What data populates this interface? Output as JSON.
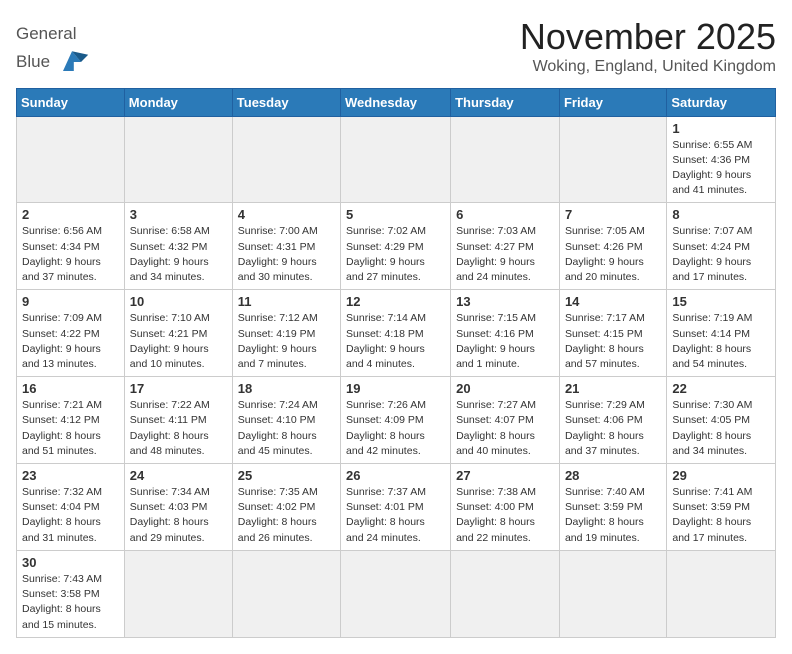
{
  "logo": {
    "line1": "General",
    "line2": "Blue"
  },
  "title": "November 2025",
  "subtitle": "Woking, England, United Kingdom",
  "headers": [
    "Sunday",
    "Monday",
    "Tuesday",
    "Wednesday",
    "Thursday",
    "Friday",
    "Saturday"
  ],
  "weeks": [
    [
      {
        "day": "",
        "info": ""
      },
      {
        "day": "",
        "info": ""
      },
      {
        "day": "",
        "info": ""
      },
      {
        "day": "",
        "info": ""
      },
      {
        "day": "",
        "info": ""
      },
      {
        "day": "",
        "info": ""
      },
      {
        "day": "1",
        "info": "Sunrise: 6:55 AM\nSunset: 4:36 PM\nDaylight: 9 hours and 41 minutes."
      }
    ],
    [
      {
        "day": "2",
        "info": "Sunrise: 6:56 AM\nSunset: 4:34 PM\nDaylight: 9 hours and 37 minutes."
      },
      {
        "day": "3",
        "info": "Sunrise: 6:58 AM\nSunset: 4:32 PM\nDaylight: 9 hours and 34 minutes."
      },
      {
        "day": "4",
        "info": "Sunrise: 7:00 AM\nSunset: 4:31 PM\nDaylight: 9 hours and 30 minutes."
      },
      {
        "day": "5",
        "info": "Sunrise: 7:02 AM\nSunset: 4:29 PM\nDaylight: 9 hours and 27 minutes."
      },
      {
        "day": "6",
        "info": "Sunrise: 7:03 AM\nSunset: 4:27 PM\nDaylight: 9 hours and 24 minutes."
      },
      {
        "day": "7",
        "info": "Sunrise: 7:05 AM\nSunset: 4:26 PM\nDaylight: 9 hours and 20 minutes."
      },
      {
        "day": "8",
        "info": "Sunrise: 7:07 AM\nSunset: 4:24 PM\nDaylight: 9 hours and 17 minutes."
      }
    ],
    [
      {
        "day": "9",
        "info": "Sunrise: 7:09 AM\nSunset: 4:22 PM\nDaylight: 9 hours and 13 minutes."
      },
      {
        "day": "10",
        "info": "Sunrise: 7:10 AM\nSunset: 4:21 PM\nDaylight: 9 hours and 10 minutes."
      },
      {
        "day": "11",
        "info": "Sunrise: 7:12 AM\nSunset: 4:19 PM\nDaylight: 9 hours and 7 minutes."
      },
      {
        "day": "12",
        "info": "Sunrise: 7:14 AM\nSunset: 4:18 PM\nDaylight: 9 hours and 4 minutes."
      },
      {
        "day": "13",
        "info": "Sunrise: 7:15 AM\nSunset: 4:16 PM\nDaylight: 9 hours and 1 minute."
      },
      {
        "day": "14",
        "info": "Sunrise: 7:17 AM\nSunset: 4:15 PM\nDaylight: 8 hours and 57 minutes."
      },
      {
        "day": "15",
        "info": "Sunrise: 7:19 AM\nSunset: 4:14 PM\nDaylight: 8 hours and 54 minutes."
      }
    ],
    [
      {
        "day": "16",
        "info": "Sunrise: 7:21 AM\nSunset: 4:12 PM\nDaylight: 8 hours and 51 minutes."
      },
      {
        "day": "17",
        "info": "Sunrise: 7:22 AM\nSunset: 4:11 PM\nDaylight: 8 hours and 48 minutes."
      },
      {
        "day": "18",
        "info": "Sunrise: 7:24 AM\nSunset: 4:10 PM\nDaylight: 8 hours and 45 minutes."
      },
      {
        "day": "19",
        "info": "Sunrise: 7:26 AM\nSunset: 4:09 PM\nDaylight: 8 hours and 42 minutes."
      },
      {
        "day": "20",
        "info": "Sunrise: 7:27 AM\nSunset: 4:07 PM\nDaylight: 8 hours and 40 minutes."
      },
      {
        "day": "21",
        "info": "Sunrise: 7:29 AM\nSunset: 4:06 PM\nDaylight: 8 hours and 37 minutes."
      },
      {
        "day": "22",
        "info": "Sunrise: 7:30 AM\nSunset: 4:05 PM\nDaylight: 8 hours and 34 minutes."
      }
    ],
    [
      {
        "day": "23",
        "info": "Sunrise: 7:32 AM\nSunset: 4:04 PM\nDaylight: 8 hours and 31 minutes."
      },
      {
        "day": "24",
        "info": "Sunrise: 7:34 AM\nSunset: 4:03 PM\nDaylight: 8 hours and 29 minutes."
      },
      {
        "day": "25",
        "info": "Sunrise: 7:35 AM\nSunset: 4:02 PM\nDaylight: 8 hours and 26 minutes."
      },
      {
        "day": "26",
        "info": "Sunrise: 7:37 AM\nSunset: 4:01 PM\nDaylight: 8 hours and 24 minutes."
      },
      {
        "day": "27",
        "info": "Sunrise: 7:38 AM\nSunset: 4:00 PM\nDaylight: 8 hours and 22 minutes."
      },
      {
        "day": "28",
        "info": "Sunrise: 7:40 AM\nSunset: 3:59 PM\nDaylight: 8 hours and 19 minutes."
      },
      {
        "day": "29",
        "info": "Sunrise: 7:41 AM\nSunset: 3:59 PM\nDaylight: 8 hours and 17 minutes."
      }
    ],
    [
      {
        "day": "30",
        "info": "Sunrise: 7:43 AM\nSunset: 3:58 PM\nDaylight: 8 hours and 15 minutes."
      },
      {
        "day": "",
        "info": ""
      },
      {
        "day": "",
        "info": ""
      },
      {
        "day": "",
        "info": ""
      },
      {
        "day": "",
        "info": ""
      },
      {
        "day": "",
        "info": ""
      },
      {
        "day": "",
        "info": ""
      }
    ]
  ]
}
